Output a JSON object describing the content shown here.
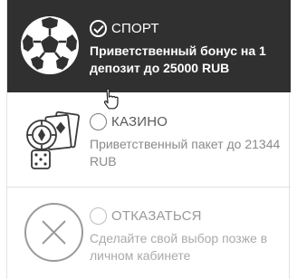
{
  "options": {
    "sport": {
      "label": "СПОРТ",
      "description": "Приветственный бонус на 1 депозит до 25000 RUB",
      "selected": true,
      "icon": "soccer-ball-icon"
    },
    "casino": {
      "label": "КАЗИНО",
      "description": "Приветственный пакет до 21344 RUB",
      "selected": false,
      "icon": "casino-chips-cards-dice-icon"
    },
    "decline": {
      "label": "ОТКАЗАТЬСЯ",
      "description": "Сделайте свой выбор позже в личном кабинете",
      "selected": false,
      "icon": "close-circle-icon"
    }
  },
  "colors": {
    "selected_bg": "#303030",
    "selected_text": "#ffffff",
    "muted_text": "#8a8a8a",
    "disabled_text": "#aaaaaa"
  }
}
